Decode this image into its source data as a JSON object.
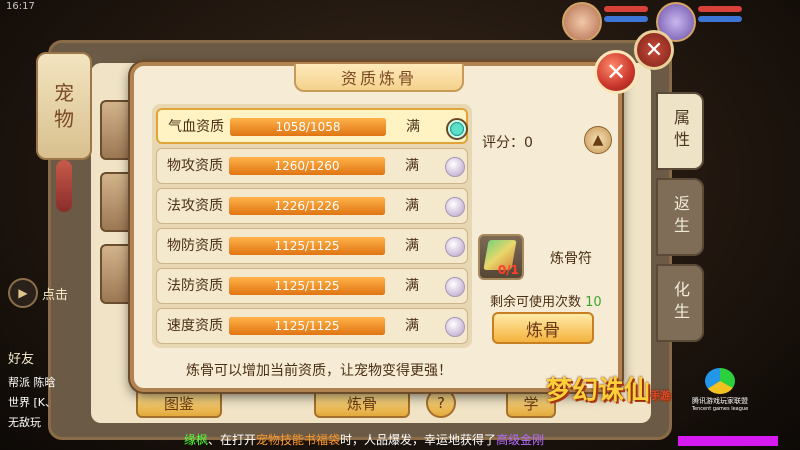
{
  "status_bar": {
    "time": "16:17"
  },
  "background_window": {
    "lantern_text": [
      "宠",
      "物"
    ],
    "side_tabs": [
      "属性",
      "返生",
      "化生"
    ],
    "bottom_buttons": {
      "catalog": "图鉴",
      "refine": "炼骨",
      "help": "?",
      "learn": "学"
    }
  },
  "left_hud": {
    "play_label": "点击",
    "friend_label": "好友",
    "chat_rows": [
      "帮派 陈晗",
      "世界 [K、",
      "无敌玩"
    ]
  },
  "dialog": {
    "title": "资质炼骨",
    "attributes": [
      {
        "name": "气血资质",
        "value": "1058/1058",
        "fill": 1.0,
        "full_label": "满",
        "selected": true
      },
      {
        "name": "物攻资质",
        "value": "1260/1260",
        "fill": 1.0,
        "full_label": "满",
        "selected": false
      },
      {
        "name": "法攻资质",
        "value": "1226/1226",
        "fill": 1.0,
        "full_label": "满",
        "selected": false
      },
      {
        "name": "物防资质",
        "value": "1125/1125",
        "fill": 1.0,
        "full_label": "满",
        "selected": false
      },
      {
        "name": "法防资质",
        "value": "1125/1125",
        "fill": 1.0,
        "full_label": "满",
        "selected": false
      },
      {
        "name": "速度资质",
        "value": "1125/1125",
        "fill": 1.0,
        "full_label": "满",
        "selected": false
      }
    ],
    "score_label": "评分：0",
    "item": {
      "name": "炼骨符",
      "count": "0/1"
    },
    "remain_label": "剩余可使用次数",
    "remain_count": "10",
    "refine_button": "炼骨",
    "hint": "炼骨可以增加当前资质，让宠物变得更强！"
  },
  "broadcast": {
    "player": "缘枫",
    "part1": "、在打开",
    "item": "宠物技能书福袋",
    "part2": "时，人品爆发，幸运地获得了",
    "reward": "高级金刚"
  },
  "branding": {
    "game_logo": "梦幻诛仙",
    "game_logo_sub": "手游",
    "publisher": "腾讯游戏玩家联盟",
    "publisher_en": "Tencent games league"
  },
  "colors": {
    "accent_orange": "#e07512",
    "reward_purple": "#b46cff",
    "remain_green": "#3da52f"
  }
}
